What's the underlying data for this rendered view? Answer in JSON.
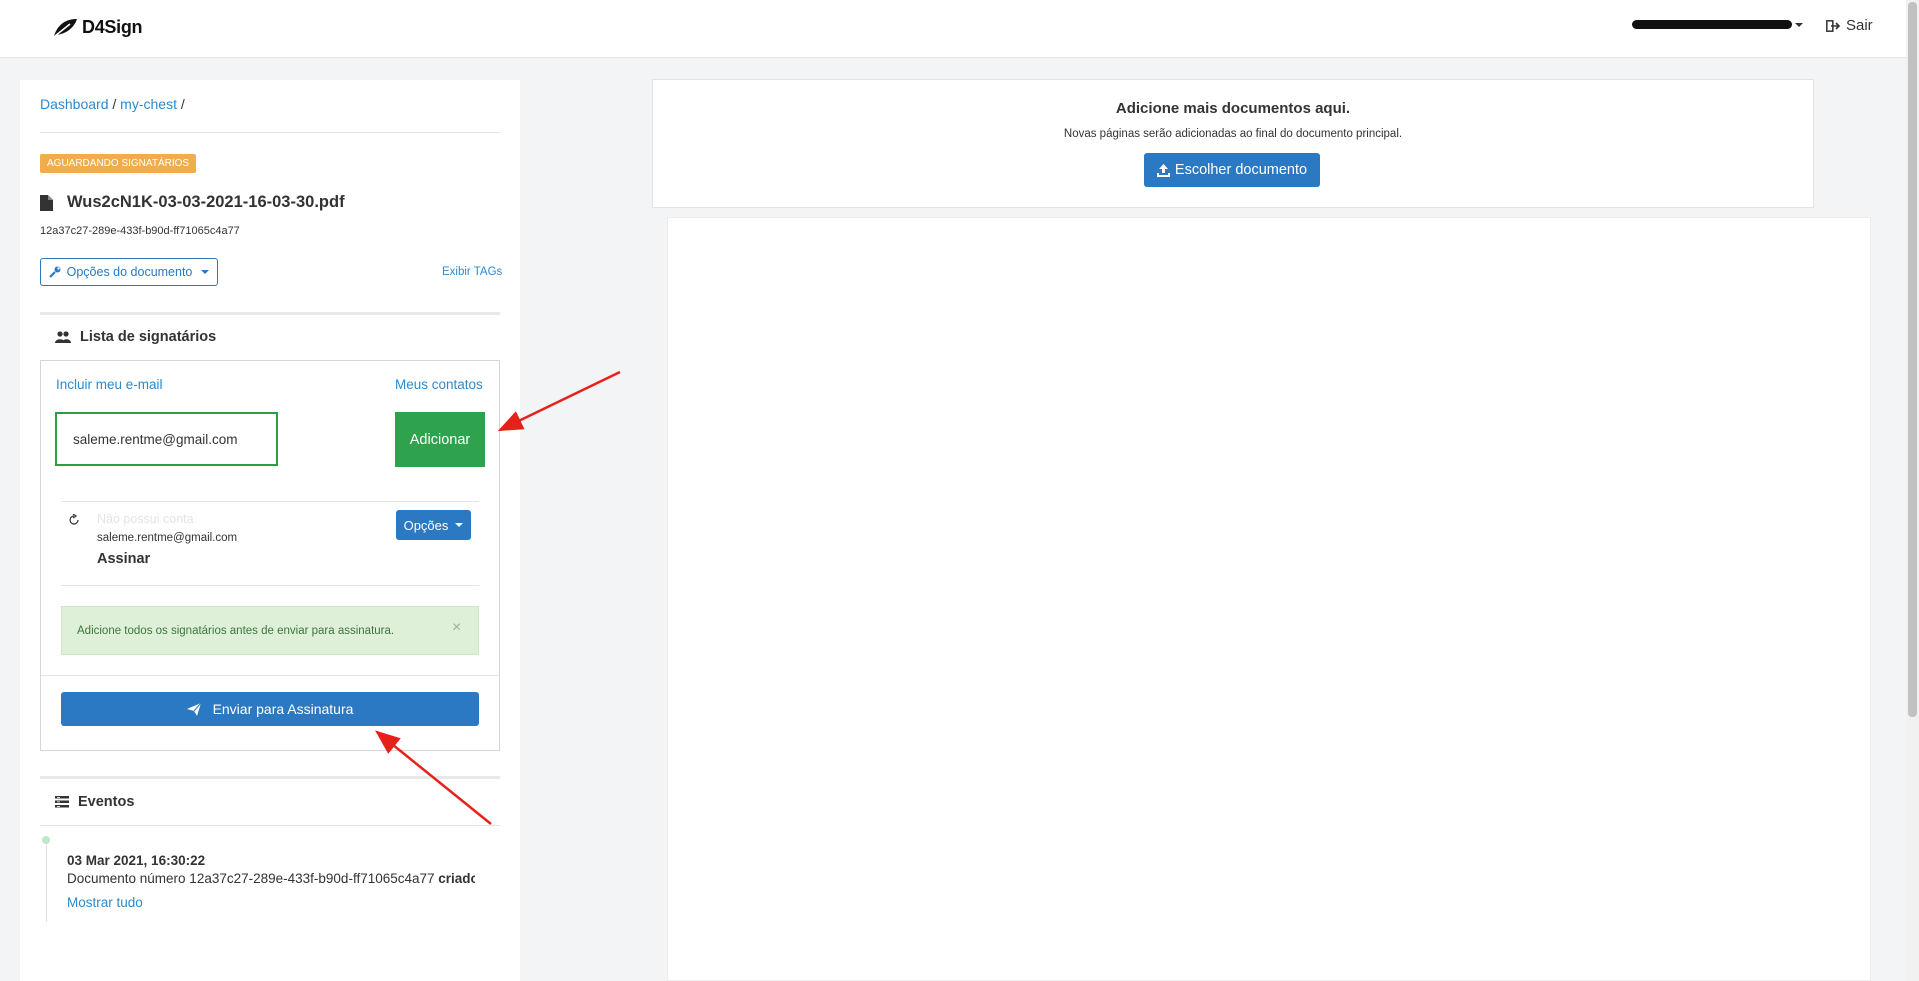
{
  "header": {
    "logo": "D4Sign",
    "logout_label": "Sair"
  },
  "breadcrumb": {
    "items": [
      "Dashboard",
      "my-chest"
    ],
    "separator": "/"
  },
  "document": {
    "status": "AGUARDANDO SIGNATÁRIOS",
    "filename": "Wus2cN1K-03-03-2021-16-03-30.pdf",
    "hash": "12a37c27-289e-433f-b90d-ff71065c4a77",
    "options_label": "Opções do documento",
    "show_tags_label": "Exibir TAGs"
  },
  "signers": {
    "section_title": "Lista de signatários",
    "include_my_email": "Incluir meu e-mail",
    "my_contacts": "Meus contatos",
    "email_value": "saleme.rentme@gmail.com",
    "add_label": "Adicionar",
    "list": [
      {
        "status": "Não possui conta",
        "email": "saleme.rentme@gmail.com",
        "action": "Assinar",
        "options_label": "Opções"
      }
    ],
    "alert": "Adicione todos os signatários antes de enviar para assinatura.",
    "alert_close": "×",
    "send_label": "Enviar para Assinatura"
  },
  "events": {
    "section_title": "Eventos",
    "items": [
      {
        "date": "03 Mar 2021, 16:30:22",
        "desc_prefix": "Documento número 12a37c27-289e-433f-b90d-ff71065c4a77 ",
        "desc_bold": "criado"
      }
    ],
    "show_all": "Mostrar tudo"
  },
  "upload": {
    "title": "Adicione mais documentos aqui.",
    "subtitle": "Novas páginas serão adicionadas ao final do documento principal.",
    "choose_label": "Escolher documento"
  },
  "colors": {
    "primary": "#2b79c2",
    "link": "#2b8ad0",
    "success": "#2fa24e",
    "warning_badge": "#f0ad4e",
    "alert_bg": "#dff0d8",
    "annotation_arrow": "#e8201a"
  },
  "icons": [
    "d4sign-leaf-icon",
    "logout-icon",
    "file-icon",
    "wrench-icon",
    "users-icon",
    "refresh-icon",
    "paper-plane-icon",
    "list-icon",
    "upload-icon",
    "caret-down-icon"
  ]
}
